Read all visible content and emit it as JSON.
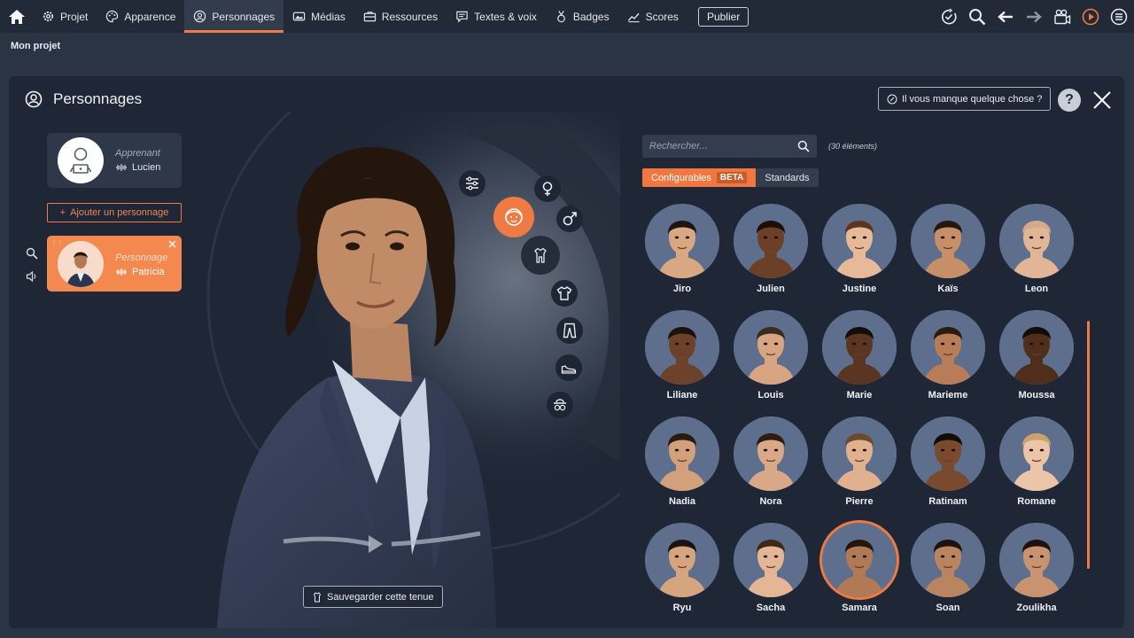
{
  "nav": {
    "items": [
      {
        "label": "Projet",
        "icon": "gear-icon"
      },
      {
        "label": "Apparence",
        "icon": "palette-icon"
      },
      {
        "label": "Personnages",
        "icon": "person-circle-icon",
        "active": true
      },
      {
        "label": "Médias",
        "icon": "media-icon"
      },
      {
        "label": "Ressources",
        "icon": "briefcase-icon"
      },
      {
        "label": "Textes & voix",
        "icon": "speech-bubble-icon"
      },
      {
        "label": "Badges",
        "icon": "medal-icon"
      },
      {
        "label": "Scores",
        "icon": "chart-icon"
      }
    ],
    "publish_label": "Publier"
  },
  "project": {
    "title": "Mon projet"
  },
  "panel": {
    "title": "Personnages",
    "missing_label": "Il vous manque quelque chose ?",
    "help_label": "?"
  },
  "learner": {
    "role": "Apprenant",
    "name": "Lucien"
  },
  "add_character_label": "Ajouter un personnage",
  "selected_character": {
    "role": "Personnage",
    "name": "Patricia"
  },
  "save_outfit_label": "Sauvegarder cette tenue",
  "search": {
    "placeholder": "Rechercher...",
    "count": "(30 éléments)"
  },
  "tabs": {
    "configurables": "Configurables",
    "beta": "BETA",
    "standards": "Standards"
  },
  "characters": [
    {
      "name": "Jiro",
      "skin": "#d9a883",
      "hair": "#1b1410"
    },
    {
      "name": "Julien",
      "skin": "#6b4027",
      "hair": "#1a100a"
    },
    {
      "name": "Justine",
      "skin": "#e6b999",
      "hair": "#5a3520"
    },
    {
      "name": "Kaïs",
      "skin": "#c68f68",
      "hair": "#221710"
    },
    {
      "name": "Leon",
      "skin": "#e2b596",
      "hair": "#d5a98a"
    },
    {
      "name": "Liliane",
      "skin": "#6d422a",
      "hair": "#1c120c"
    },
    {
      "name": "Louis",
      "skin": "#d8a583",
      "hair": "#3a2a20"
    },
    {
      "name": "Marie",
      "skin": "#5a3521",
      "hair": "#140d08"
    },
    {
      "name": "Marieme",
      "skin": "#b87d58",
      "hair": "#2a1a10"
    },
    {
      "name": "Moussa",
      "skin": "#4f2e1c",
      "hair": "#130c08"
    },
    {
      "name": "Nadia",
      "skin": "#d3a07c",
      "hair": "#2a1a10"
    },
    {
      "name": "Nora",
      "skin": "#d9a987",
      "hair": "#2c1d14"
    },
    {
      "name": "Pierre",
      "skin": "#e1b08f",
      "hair": "#6b4a30"
    },
    {
      "name": "Ratinam",
      "skin": "#7a4a2e",
      "hair": "#120c08"
    },
    {
      "name": "Romane",
      "skin": "#ecc4a8",
      "hair": "#c9a26c"
    },
    {
      "name": "Ryu",
      "skin": "#d5a57f",
      "hair": "#1a1410"
    },
    {
      "name": "Sacha",
      "skin": "#e4b695",
      "hair": "#3e2818"
    },
    {
      "name": "Samara",
      "skin": "#b07a57",
      "hair": "#24160c",
      "selected": true
    },
    {
      "name": "Soan",
      "skin": "#b98560",
      "hair": "#1c130d"
    },
    {
      "name": "Zoulikha",
      "skin": "#c99370",
      "hair": "#1d130b"
    }
  ],
  "colors": {
    "accent": "#f07a44",
    "panel": "#1f2736",
    "portrait_bg": "#5d6f8c"
  }
}
